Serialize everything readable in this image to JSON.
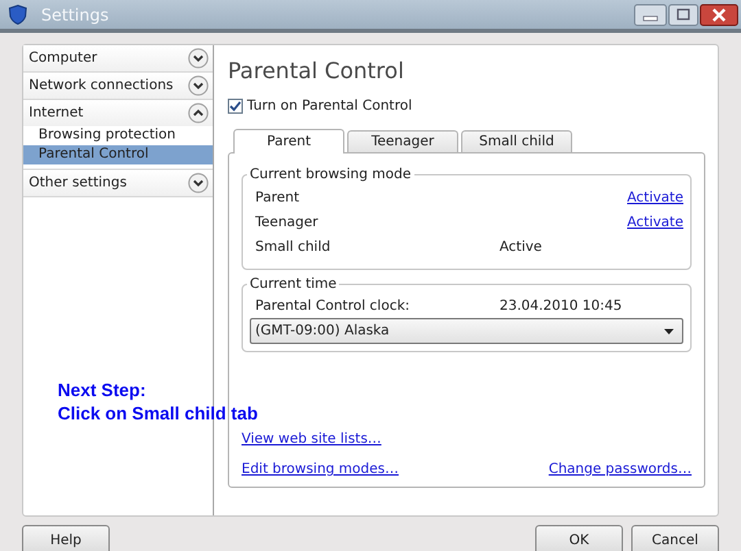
{
  "window": {
    "title": "Settings"
  },
  "sidebar": {
    "sections": [
      {
        "label": "Computer",
        "expanded": false
      },
      {
        "label": "Network connections",
        "expanded": false
      },
      {
        "label": "Internet",
        "expanded": true,
        "children": [
          {
            "label": "Browsing protection",
            "selected": false
          },
          {
            "label": "Parental Control",
            "selected": true
          }
        ]
      },
      {
        "label": "Other settings",
        "expanded": false
      }
    ]
  },
  "page": {
    "title": "Parental Control",
    "enable_checkbox": {
      "label": "Turn on Parental Control",
      "checked": true
    },
    "tabs": [
      {
        "label": "Parent",
        "selected": true
      },
      {
        "label": "Teenager",
        "selected": false
      },
      {
        "label": "Small child",
        "selected": false
      }
    ],
    "browsing_mode": {
      "title": "Current browsing mode",
      "rows": [
        {
          "label": "Parent",
          "kind": "link",
          "value": "Activate"
        },
        {
          "label": "Teenager",
          "kind": "link",
          "value": "Activate"
        },
        {
          "label": "Small child",
          "kind": "status",
          "value": "Active"
        }
      ]
    },
    "current_time": {
      "title": "Current time",
      "clock_label": "Parental Control clock:",
      "clock_value": "23.04.2010 10:45",
      "timezone": "(GMT-09:00) Alaska"
    },
    "links": [
      "View web site lists…",
      "Edit browsing modes…"
    ],
    "change_passwords": "Change passwords…"
  },
  "annotation": {
    "lines": [
      "Next Step:",
      "Click on Small child tab"
    ]
  },
  "buttons": {
    "help": "Help",
    "ok": "OK",
    "cancel": "Cancel"
  }
}
